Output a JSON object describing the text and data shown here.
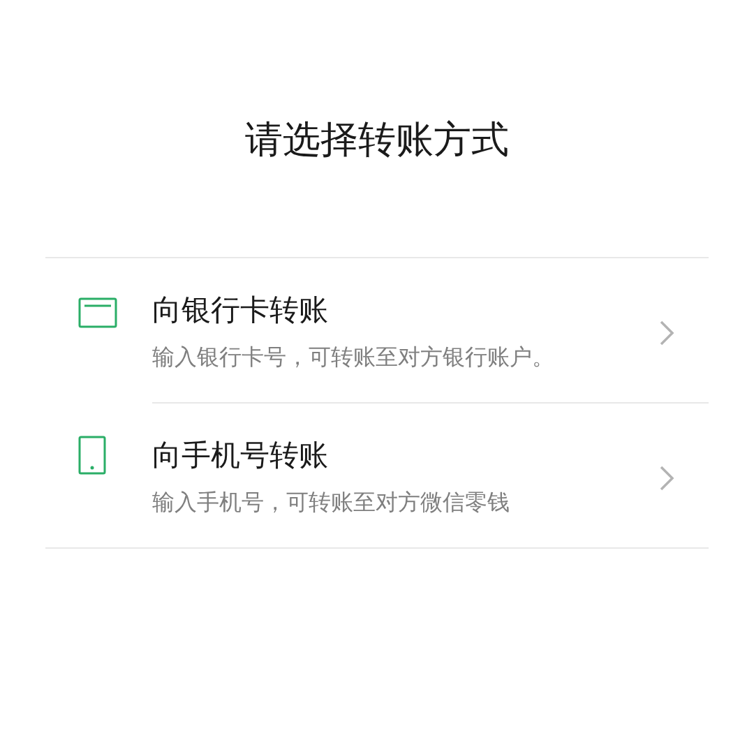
{
  "title": "请选择转账方式",
  "options": [
    {
      "kind": "bank-card",
      "label": "向银行卡转账",
      "description": "输入银行卡号，可转账至对方银行账户。"
    },
    {
      "kind": "phone",
      "label": "向手机号转账",
      "description": "输入手机号，可转账至对方微信零钱"
    }
  ]
}
